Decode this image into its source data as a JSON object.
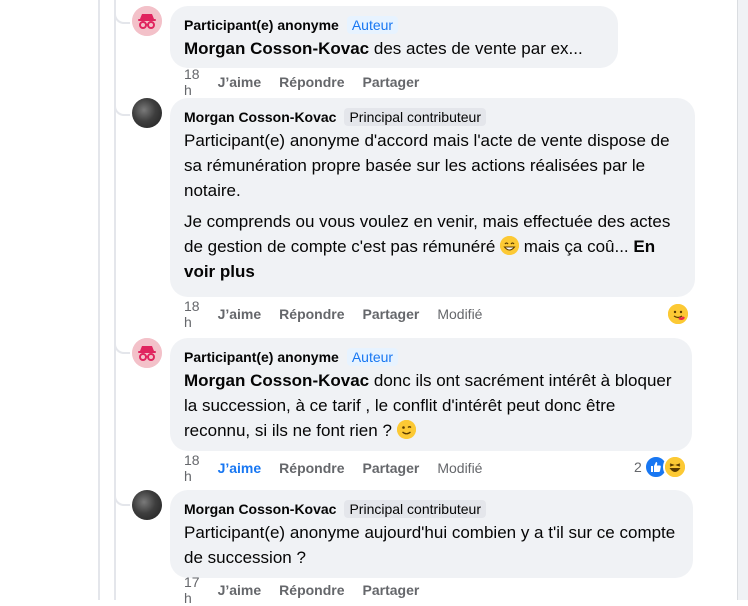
{
  "comments": [
    {
      "author": "Participant(e) anonyme",
      "badge": "Auteur",
      "mention": "Morgan Cosson-Kovac",
      "text": " des actes de vente par ex...",
      "time": "18 h",
      "like": "J’aime",
      "reply": "Répondre",
      "share": "Partager"
    },
    {
      "author": "Morgan Cosson-Kovac",
      "badge": "Principal contributeur",
      "para1": "Participant(e) anonyme d'accord mais l'acte de vente dispose de sa rémunération propre basée sur les actions réalisées par le notaire.",
      "para2": "Je comprends ou vous voulez en venir, mais effectuée des actes de gestion de compte c'est pas rémunéré ",
      "para2b": " mais ça coû... ",
      "more": "En voir plus",
      "time": "18 h",
      "like": "J’aime",
      "reply": "Répondre",
      "share": "Partager",
      "edited": "Modifié"
    },
    {
      "author": "Participant(e) anonyme",
      "badge": "Auteur",
      "mention": "Morgan Cosson-Kovac",
      "text": " donc ils ont sacrément intérêt à bloquer la succession, à ce tarif , le conflit d'intérêt peut donc être reconnu, si ils ne font rien ? ",
      "time": "18 h",
      "like": "J’aime",
      "reply": "Répondre",
      "share": "Partager",
      "edited": "Modifié",
      "reaction_count": "2"
    },
    {
      "author": "Morgan Cosson-Kovac",
      "badge": "Principal contributeur",
      "text": "Participant(e) anonyme aujourd'hui combien y a t'il sur ce compte de succession ?",
      "time": "17 h",
      "like": "J’aime",
      "reply": "Répondre",
      "share": "Partager"
    }
  ],
  "colors": {
    "accent": "#1877f2",
    "bubble": "#f0f2f5",
    "meta": "#65676b"
  },
  "icons": [
    "anonymous-avatar-icon",
    "grin-emoji-icon",
    "wink-emoji-icon",
    "like-reaction-icon",
    "haha-reaction-icon",
    "hug-reaction-icon"
  ]
}
